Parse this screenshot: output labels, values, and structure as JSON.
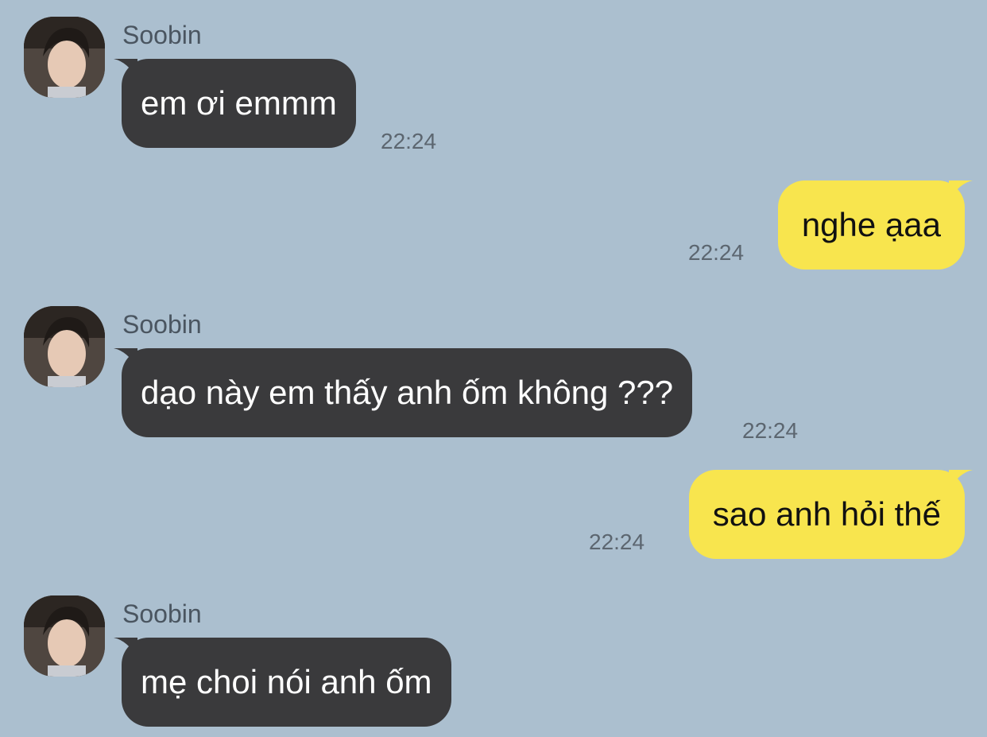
{
  "colors": {
    "background": "#abbfcf",
    "incoming_bubble": "#3a3a3c",
    "outgoing_bubble": "#f8e54e",
    "timestamp": "#5c6670"
  },
  "messages": [
    {
      "direction": "incoming",
      "sender": "Soobin",
      "avatar_icon": "profile-photo",
      "text": "em ơi emmm",
      "time": "22:24"
    },
    {
      "direction": "outgoing",
      "text": "nghe ạaa",
      "time": "22:24"
    },
    {
      "direction": "incoming",
      "sender": "Soobin",
      "avatar_icon": "profile-photo",
      "text": "dạo này em thấy anh ốm không ???",
      "time": "22:24"
    },
    {
      "direction": "outgoing",
      "text": "sao anh hỏi thế",
      "time": "22:24"
    },
    {
      "direction": "incoming",
      "sender": "Soobin",
      "avatar_icon": "profile-photo",
      "text": "mẹ choi nói anh ốm"
    }
  ]
}
